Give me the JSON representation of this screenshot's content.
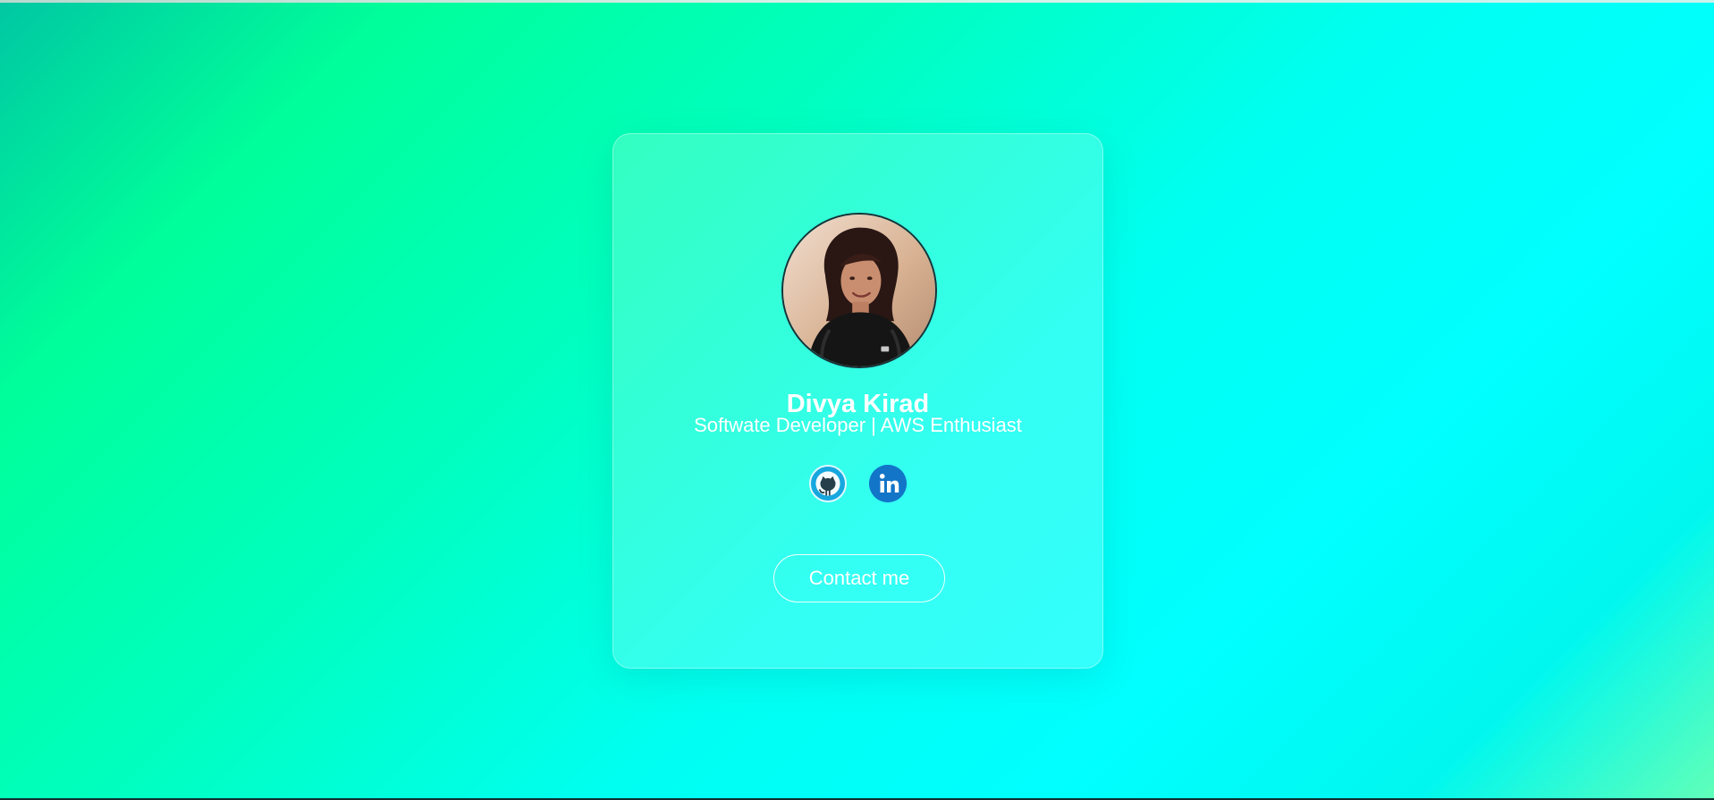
{
  "profile": {
    "name": "Divya Kirad",
    "role": "Softwate Developer | AWS Enthusiast",
    "avatar": "profile-photo"
  },
  "social_links": [
    {
      "name": "GitHub",
      "icon": "github-icon"
    },
    {
      "name": "LinkedIn",
      "icon": "linkedin-icon"
    }
  ],
  "contact": {
    "label": "Contact me"
  },
  "colors": {
    "background_start": "#00c7a3",
    "background_mid": "#00ff9a",
    "background_end": "#00ffff",
    "card_tint": "#ffffff",
    "github": "#16a7df",
    "linkedin": "#1275c8",
    "text": "#ffffff"
  }
}
